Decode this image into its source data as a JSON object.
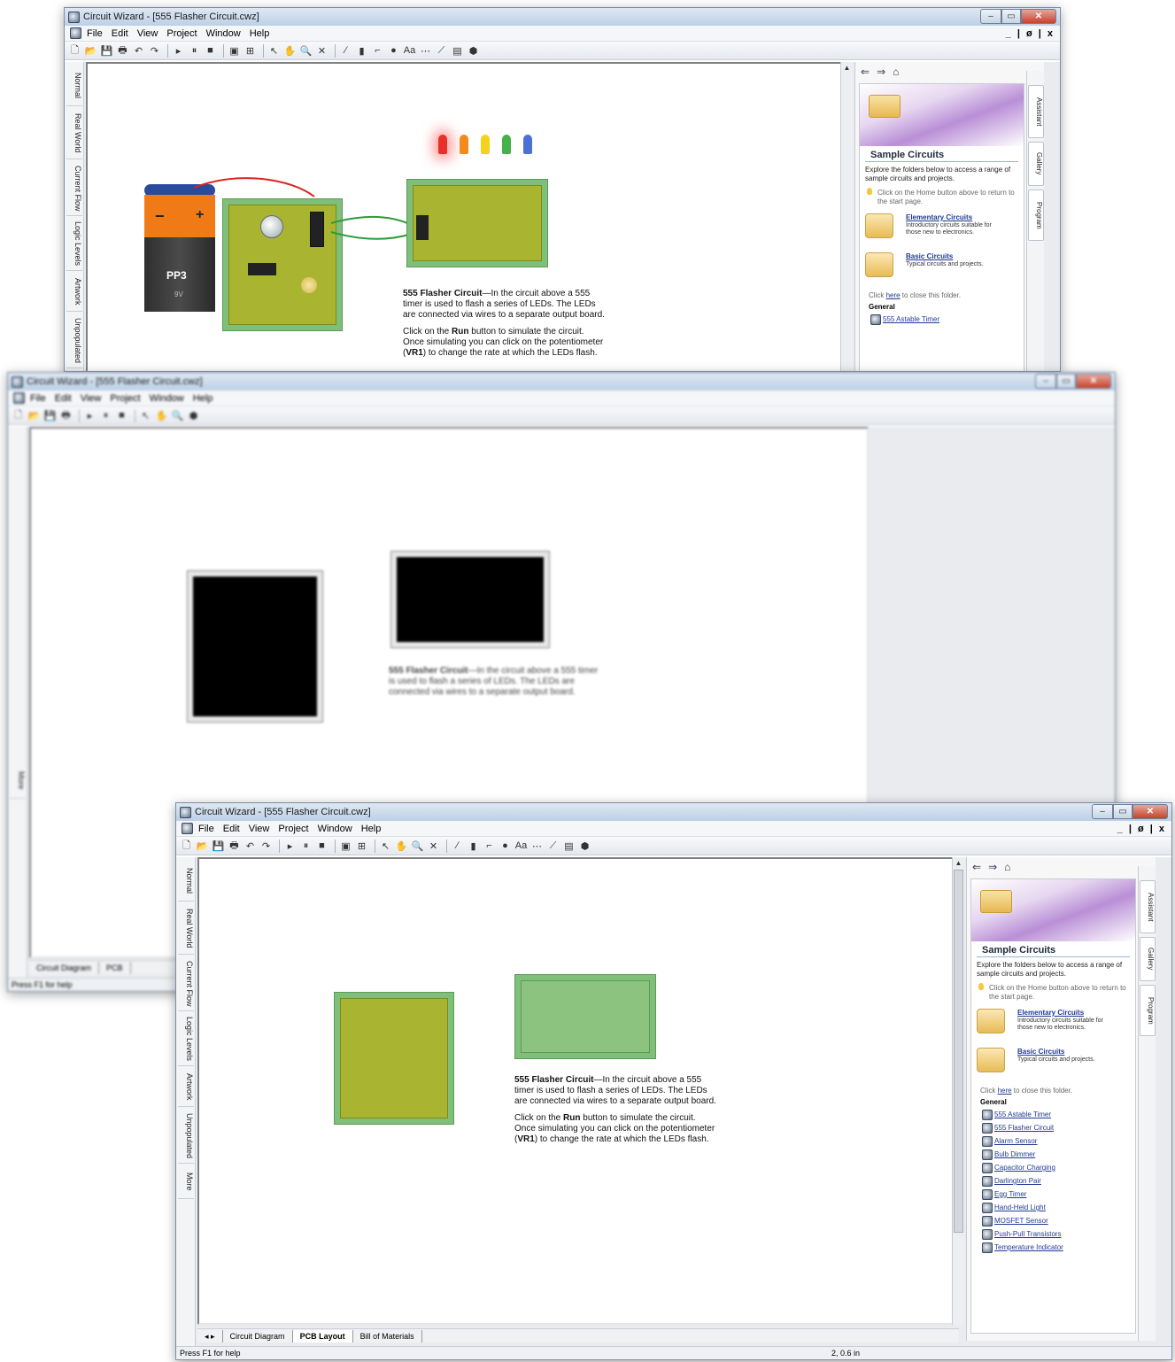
{
  "window1": {
    "title": "Circuit Wizard - [555 Flasher Circuit.cwz]",
    "menus": [
      "File",
      "Edit",
      "View",
      "Project",
      "Window",
      "Help"
    ],
    "mdi_controls": "_ | ø | x",
    "left_tabs": [
      "Normal",
      "Real World",
      "Current Flow",
      "Logic Levels",
      "Artwork",
      "Unpopulated"
    ],
    "battery_label": "PP3",
    "battery_voltage": "9V",
    "battery_minus": "−",
    "battery_plus": "+",
    "description": {
      "p1_bold": "555 Flasher Circuit",
      "p1_rest": "—In the circuit above a 555 timer is used to flash a series of LEDs. The LEDs are connected via wires to a separate output board.",
      "p2_a": "Click on the ",
      "p2_bold1": "Run",
      "p2_b": " button to simulate the circuit. Once simulating you can click on the potentiometer (",
      "p2_bold2": "VR1",
      "p2_c": ") to change the rate at which the LEDs flash."
    },
    "led_colors": [
      "#e8302a",
      "#f28a1e",
      "#f2d21e",
      "#48b04a",
      "#4a72d6"
    ]
  },
  "window2": {
    "title": "Circuit Wizard - [555 Flasher Circuit.cwz]",
    "menus": [
      "File",
      "Edit",
      "View",
      "Project",
      "Window",
      "Help"
    ],
    "bottom_tabs": [
      "Circuit Diagram",
      "PCB"
    ],
    "status": "Press F1 for help",
    "more_tab": "More"
  },
  "window3": {
    "title": "Circuit Wizard - [555 Flasher Circuit.cwz]",
    "menus": [
      "File",
      "Edit",
      "View",
      "Project",
      "Window",
      "Help"
    ],
    "left_tabs": [
      "Normal",
      "Real World",
      "Current Flow",
      "Logic Levels",
      "Artwork",
      "Unpopulated",
      "More"
    ],
    "bottom_tabs": [
      "Circuit Diagram",
      "PCB Layout",
      "Bill of Materials"
    ],
    "status": "Press F1 for help",
    "coord": "2, 0.6 in"
  },
  "assistant": {
    "title": "Sample Circuits",
    "intro": "Explore the folders below to access a range of sample circuits and projects.",
    "hint": "Click on the Home button above to return to the start page.",
    "categories": [
      {
        "name": "Elementary Circuits",
        "desc": "Introductory circuits suitable for those new to electronics."
      },
      {
        "name": "Basic Circuits",
        "desc": "Typical circuits and projects."
      }
    ],
    "close_a": "Click ",
    "close_link": "here",
    "close_b": " to close this folder.",
    "general": "General",
    "samples": [
      "555 Astable Timer",
      "555 Flasher Circuit",
      "Alarm Sensor",
      "Bulb Dimmer",
      "Capacitor Charging",
      "Darlington Pair",
      "Egg Timer",
      "Hand-Held Light",
      "MOSFET Sensor",
      "Push-Pull Transistors",
      "Temperature Indicator"
    ],
    "right_tabs": [
      "Assistant",
      "Gallery",
      "Program"
    ]
  }
}
